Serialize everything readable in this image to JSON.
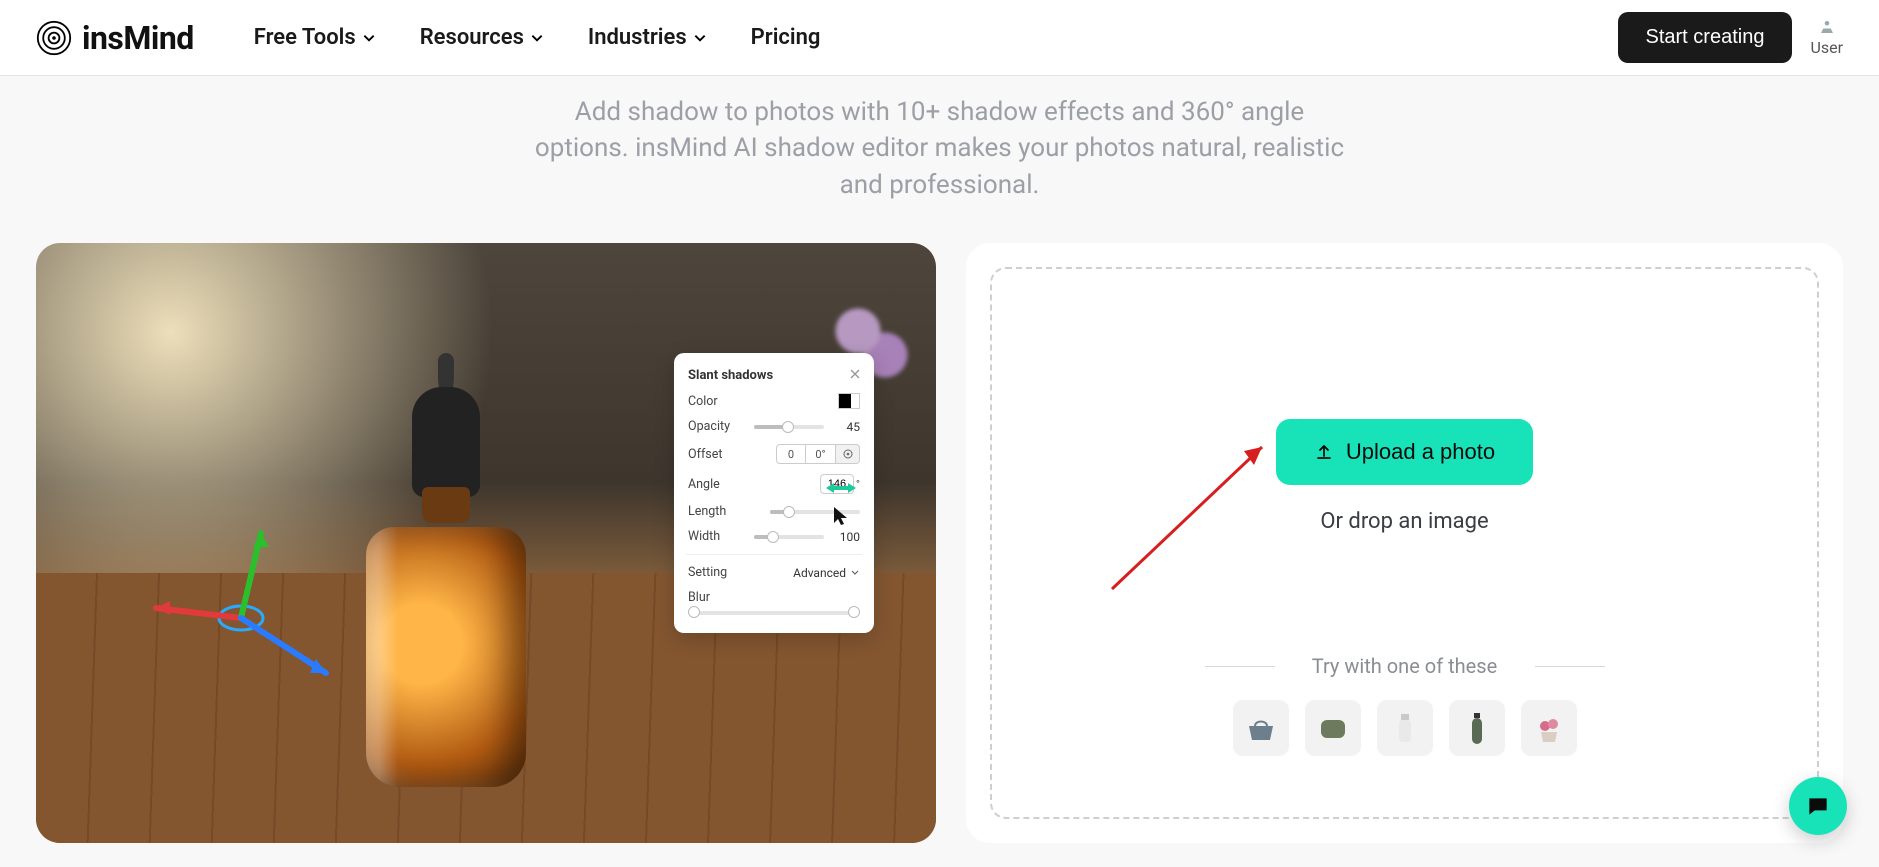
{
  "brand": {
    "name": "insMind"
  },
  "nav": {
    "free_tools": "Free Tools",
    "resources": "Resources",
    "industries": "Industries",
    "pricing": "Pricing"
  },
  "header": {
    "cta": "Start creating",
    "user_label": "User"
  },
  "hero": {
    "subtitle": "Add shadow to photos with 10+ shadow effects and 360° angle options. insMind AI shadow editor makes your photos natural, realistic and professional."
  },
  "shadow_panel": {
    "title": "Slant shadows",
    "labels": {
      "color": "Color",
      "opacity": "Opacity",
      "offset": "Offset",
      "angle": "Angle",
      "length": "Length",
      "width": "Width",
      "setting": "Setting",
      "blur": "Blur"
    },
    "values": {
      "opacity": "45",
      "offset_value": "0",
      "offset_unit": "0°",
      "angle": "146",
      "angle_unit": "°",
      "width": "100"
    },
    "setting_mode": "Advanced"
  },
  "upload": {
    "button": "Upload a photo",
    "or_drop": "Or drop an image",
    "try_label": "Try with one of these"
  },
  "samples": {
    "s1": "handbag",
    "s2": "lunchbox",
    "s3": "lotion-bottle",
    "s4": "water-bottle",
    "s5": "plant-pot"
  },
  "icons": {
    "upload": "upload-icon",
    "chevron": "chevron-down-icon",
    "close": "close-icon",
    "chat": "chat-icon",
    "user": "user-icon",
    "target": "target-icon",
    "drag": "drag-horizontal-icon",
    "cursor": "cursor-icon"
  }
}
